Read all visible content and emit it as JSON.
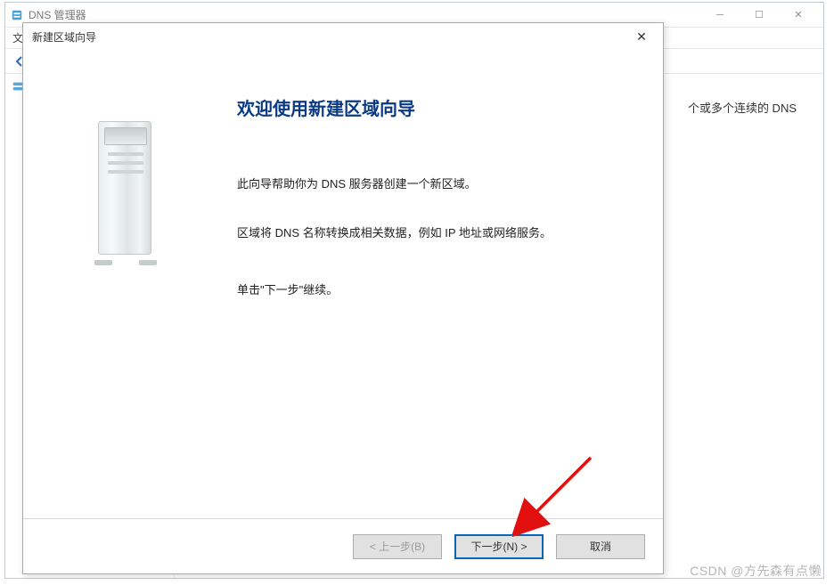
{
  "parent": {
    "title": "DNS 管理器",
    "content_hint": "个或多个连续的 DNS"
  },
  "dialog": {
    "title": "新建区域向导",
    "heading": "欢迎使用新建区域向导",
    "p1": "此向导帮助你为 DNS 服务器创建一个新区域。",
    "p2": "区域将 DNS 名称转换成相关数据，例如 IP 地址或网络服务。",
    "p3": "单击\"下一步\"继续。",
    "buttons": {
      "back": "< 上一步(B)",
      "next": "下一步(N) >",
      "cancel": "取消"
    }
  },
  "watermark": "CSDN @方先森有点懒"
}
